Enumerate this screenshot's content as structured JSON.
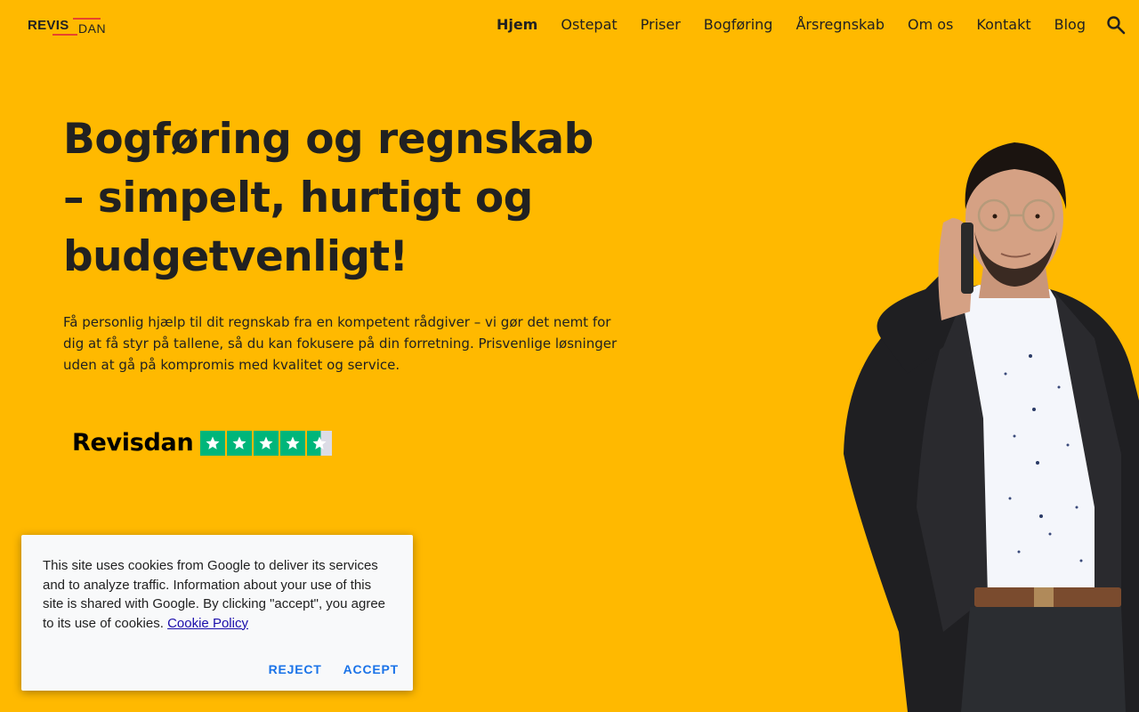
{
  "header": {
    "logo_main": "REVIS",
    "logo_sub": "DAN",
    "nav": [
      {
        "label": "Hjem",
        "active": true
      },
      {
        "label": "Ostepat"
      },
      {
        "label": "Priser"
      },
      {
        "label": "Bogføring"
      },
      {
        "label": "Årsregnskab"
      },
      {
        "label": "Om os"
      },
      {
        "label": "Kontakt"
      },
      {
        "label": "Blog"
      }
    ],
    "search_icon": "search-icon"
  },
  "hero": {
    "title": "Bogføring og regnskab – simpelt, hurtigt og budgetvenligt!",
    "lead": "Få personlig hjælp til dit regnskab fra en kompetent rådgiver – vi gør det nemt for dig at få styr på tallene, så du kan fokusere på din forretning. Prisvenlige løsninger uden at gå på kompromis med kvalitet og service."
  },
  "trustpilot": {
    "name": "Revisdan",
    "rating": 4.5,
    "max": 5
  },
  "cookie": {
    "text": "This site uses cookies from Google to deliver its services and to analyze traffic. Information about your use of this site is shared with Google. By clicking \"accept\", you agree to its use of cookies.",
    "link": "Cookie Policy",
    "reject": "REJECT",
    "accept": "ACCEPT"
  },
  "colors": {
    "background": "#FFB900",
    "accent_red": "#E8442C",
    "trustpilot_green": "#00B67A",
    "button_blue": "#1A73E8"
  }
}
